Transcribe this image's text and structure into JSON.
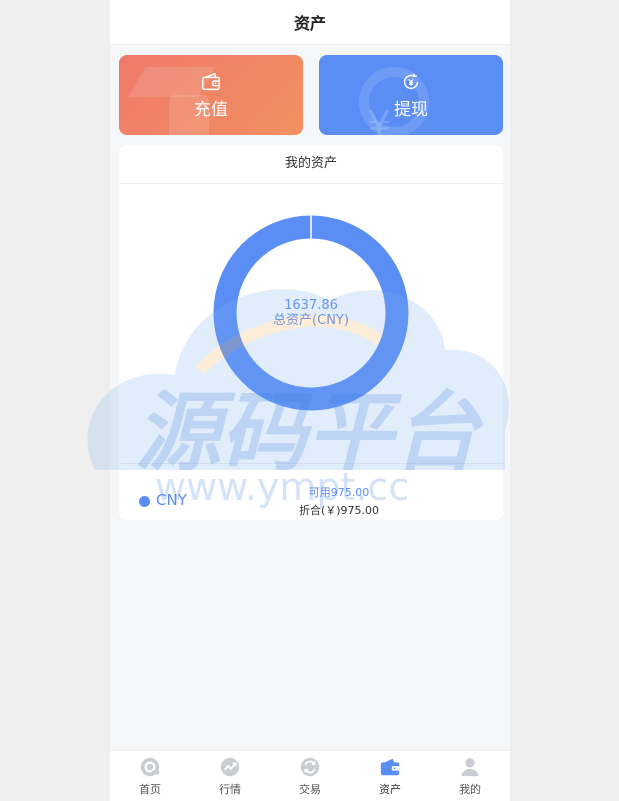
{
  "header": {
    "title": "资产"
  },
  "actions": {
    "recharge_label": "充值",
    "withdraw_label": "提现"
  },
  "assets": {
    "title": "我的资产",
    "total_value": "1637.86",
    "total_label": "总资产(CNY)",
    "share": 1.0,
    "coins": [
      {
        "name": "CNY",
        "available": "可用975.00",
        "folded": "折合(￥)975.00"
      }
    ]
  },
  "tabbar": {
    "items": [
      {
        "label": "首页",
        "icon": "home-icon"
      },
      {
        "label": "行情",
        "icon": "market-icon"
      },
      {
        "label": "交易",
        "icon": "trade-icon"
      },
      {
        "label": "资产",
        "icon": "wallet-icon"
      },
      {
        "label": "我的",
        "icon": "user-icon"
      }
    ],
    "active": 3
  },
  "watermark": {
    "text": "源码平台",
    "url": "www.ympt.cc"
  },
  "colors": {
    "accent": "#5b8ef5",
    "recharge_start": "#ef7a6c",
    "recharge_end": "#f2905f",
    "withdraw": "#5b8ef5"
  }
}
